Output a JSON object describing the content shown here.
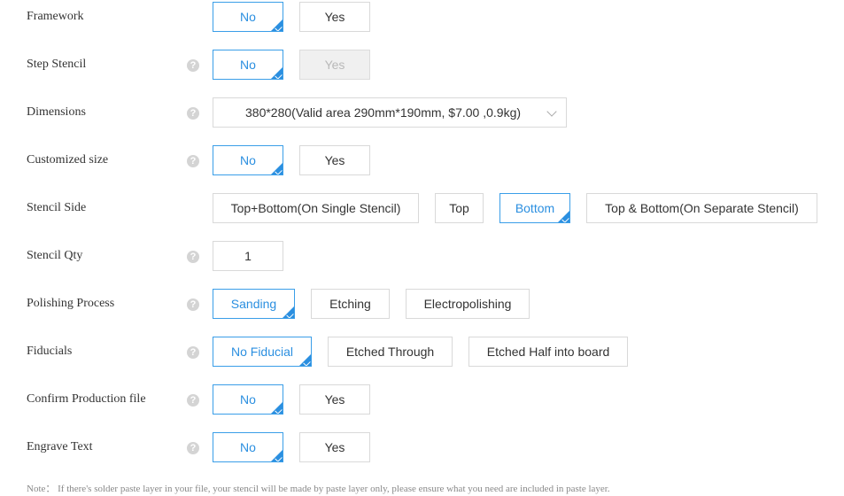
{
  "framework": {
    "label": "Framework",
    "options": [
      "No",
      "Yes"
    ]
  },
  "step_stencil": {
    "label": "Step Stencil",
    "help": "?",
    "options": [
      "No",
      "Yes"
    ]
  },
  "dimensions": {
    "label": "Dimensions",
    "help": "?",
    "selected": "380*280(Valid area 290mm*190mm, $7.00 ,0.9kg)"
  },
  "customized_size": {
    "label": "Customized size",
    "help": "?",
    "options": [
      "No",
      "Yes"
    ]
  },
  "stencil_side": {
    "label": "Stencil Side",
    "options": [
      "Top+Bottom(On Single Stencil)",
      "Top",
      "Bottom",
      "Top & Bottom(On Separate Stencil)"
    ]
  },
  "stencil_qty": {
    "label": "Stencil Qty",
    "help": "?",
    "value": "1"
  },
  "polishing_process": {
    "label": "Polishing Process",
    "help": "?",
    "options": [
      "Sanding",
      "Etching",
      "Electropolishing"
    ]
  },
  "fiducials": {
    "label": "Fiducials",
    "help": "?",
    "options": [
      "No Fiducial",
      "Etched Through",
      "Etched Half into board"
    ]
  },
  "confirm_production_file": {
    "label": "Confirm Production file",
    "help": "?",
    "options": [
      "No",
      "Yes"
    ]
  },
  "engrave_text": {
    "label": "Engrave Text",
    "help": "?",
    "options": [
      "No",
      "Yes"
    ]
  },
  "note": "Note： If there's solder paste layer in your file, your stencil will be made by paste layer only, please ensure what you need are included in paste layer.",
  "colors": {
    "accent": "#2b8fe0",
    "border": "#d9d9d9",
    "disabled_bg": "#f0f0f0",
    "help_icon": "#d4d4d4"
  }
}
